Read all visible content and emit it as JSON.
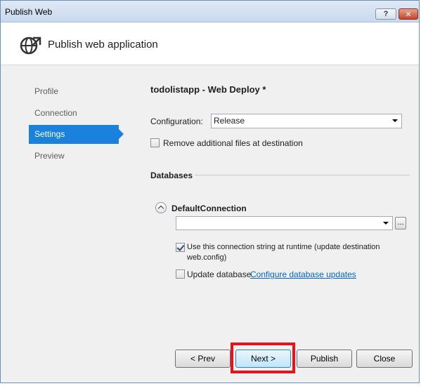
{
  "window": {
    "title": "Publish Web",
    "help_label": "?",
    "close_label": "✕"
  },
  "header": {
    "title": "Publish web application",
    "icon": "globe-publish-icon"
  },
  "nav": {
    "items": [
      {
        "label": "Profile"
      },
      {
        "label": "Connection"
      },
      {
        "label": "Settings"
      },
      {
        "label": "Preview"
      }
    ],
    "active": "Settings"
  },
  "settings": {
    "profile_heading": "todolistapp - Web Deploy *",
    "configuration_label": "Configuration:",
    "configuration_value": "Release",
    "remove_files_label": "Remove additional files at destination",
    "remove_files_checked": false,
    "databases_label": "Databases",
    "connection_name": "DefaultConnection",
    "connection_string_value": "",
    "browse_label": "...",
    "use_connection_label_line1": "Use this connection string at runtime (update destination",
    "use_connection_label_line2": "web.config)",
    "use_connection_checked": true,
    "update_database_label": "Update database",
    "configure_updates_link": "Configure database updates",
    "update_database_checked": false
  },
  "buttons": {
    "prev": "< Prev",
    "next": "Next >",
    "publish": "Publish",
    "close": "Close"
  },
  "colors": {
    "accent": "#1a82dc",
    "highlight": "#e8121c",
    "link": "#0066cc"
  }
}
